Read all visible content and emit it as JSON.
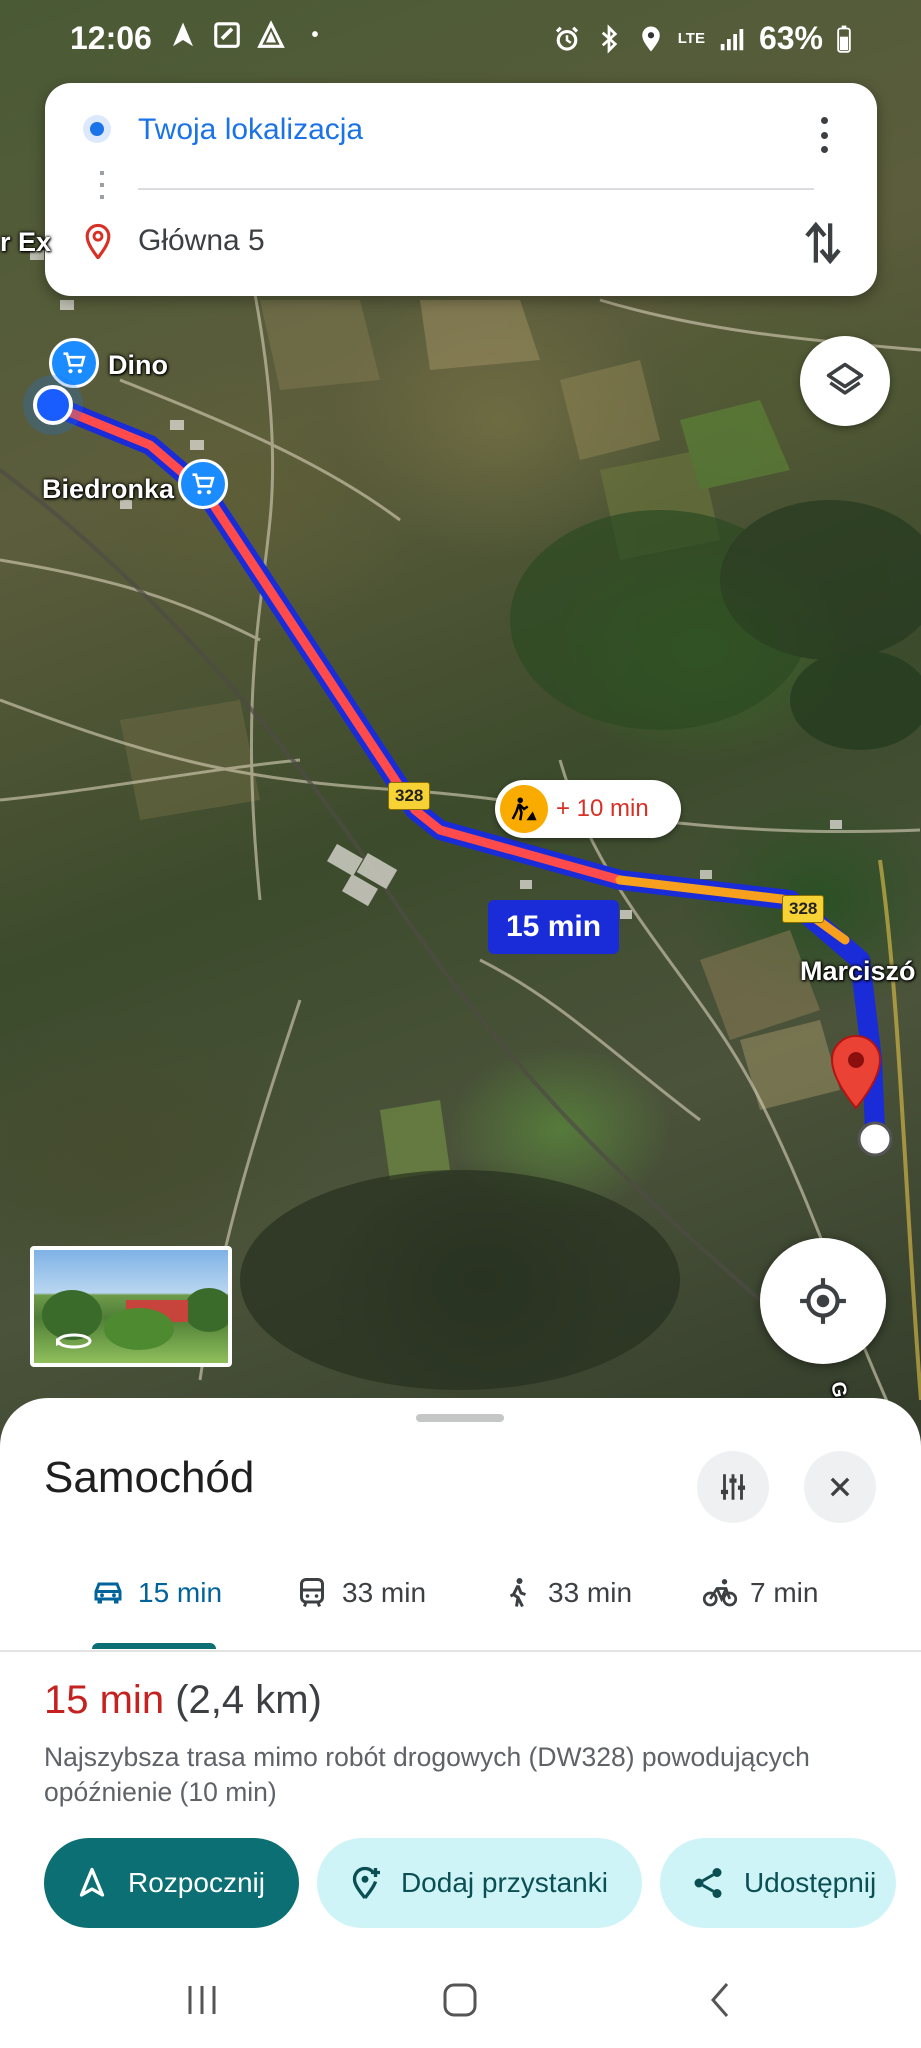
{
  "status_bar": {
    "time": "12:06",
    "battery": "63%",
    "network": "LTE"
  },
  "route_card": {
    "origin": "Twoja lokalizacja",
    "destination": "Główna 5"
  },
  "map": {
    "labels": {
      "poi_dino": "Dino",
      "poi_biedronka": "Biedronka",
      "town": "Marciszó",
      "edge_left": "r Ex",
      "edge_bottom": "Gobr"
    },
    "road_number": "328",
    "traffic_delay": "+ 10 min",
    "eta_chip": "15 min",
    "colors": {
      "route_primary": "#1a2bd8",
      "traffic_heavy": "#ff4b4b",
      "traffic_medium": "#f7a01e"
    }
  },
  "sheet": {
    "title": "Samochód",
    "modes": [
      {
        "icon": "car-icon",
        "label": "15 min"
      },
      {
        "icon": "transit-icon",
        "label": "33 min"
      },
      {
        "icon": "walk-icon",
        "label": "33 min"
      },
      {
        "icon": "bike-icon",
        "label": "7 min"
      }
    ],
    "summary": {
      "duration": "15 min",
      "distance": "(2,4 km)"
    },
    "description": "Najszybsza trasa mimo robót drogowych (DW328) powodujących opóźnienie (10 min)",
    "actions": {
      "start": "Rozpocznij",
      "add_stops": "Dodaj przystanki",
      "share": "Udostępnij"
    }
  }
}
